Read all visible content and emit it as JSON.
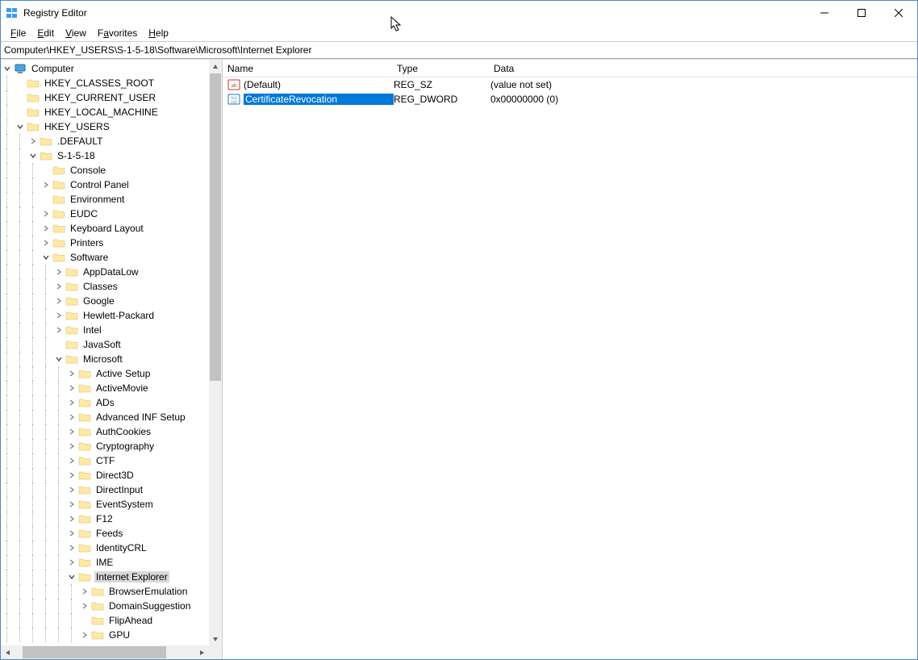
{
  "window": {
    "title": "Registry Editor"
  },
  "menu": {
    "file": "File",
    "edit": "Edit",
    "view": "View",
    "favorites": "Favorites",
    "help": "Help"
  },
  "address": "Computer\\HKEY_USERS\\S-1-5-18\\Software\\Microsoft\\Internet Explorer",
  "tree": {
    "root": "Computer",
    "hkcr": "HKEY_CLASSES_ROOT",
    "hkcu": "HKEY_CURRENT_USER",
    "hklm": "HKEY_LOCAL_MACHINE",
    "hku": "HKEY_USERS",
    "default": ".DEFAULT",
    "s1518": "S-1-5-18",
    "console": "Console",
    "controlpanel": "Control Panel",
    "environment": "Environment",
    "eudc": "EUDC",
    "keyboard": "Keyboard Layout",
    "printers": "Printers",
    "software": "Software",
    "appdatalow": "AppDataLow",
    "classes": "Classes",
    "google": "Google",
    "hp": "Hewlett-Packard",
    "intel": "Intel",
    "javasoft": "JavaSoft",
    "microsoft": "Microsoft",
    "activesetup": "Active Setup",
    "activemovie": "ActiveMovie",
    "ads": "ADs",
    "advinf": "Advanced INF Setup",
    "authcookies": "AuthCookies",
    "cryptography": "Cryptography",
    "ctf": "CTF",
    "direct3d": "Direct3D",
    "directinput": "DirectInput",
    "eventsystem": "EventSystem",
    "f12": "F12",
    "feeds": "Feeds",
    "identitycrl": "IdentityCRL",
    "ime": "IME",
    "ie": "Internet Explorer",
    "browseremulation": "BrowserEmulation",
    "domainsuggestion": "DomainSuggestion",
    "flipahead": "FlipAhead",
    "gpu": "GPU"
  },
  "columns": {
    "name": "Name",
    "type": "Type",
    "data": "Data"
  },
  "values": [
    {
      "name": "(Default)",
      "type": "REG_SZ",
      "data": "(value not set)",
      "kind": "sz",
      "selected": false
    },
    {
      "name": "CertificateRevocation",
      "type": "REG_DWORD",
      "data": "0x00000000 (0)",
      "kind": "dword",
      "selected": true
    }
  ]
}
